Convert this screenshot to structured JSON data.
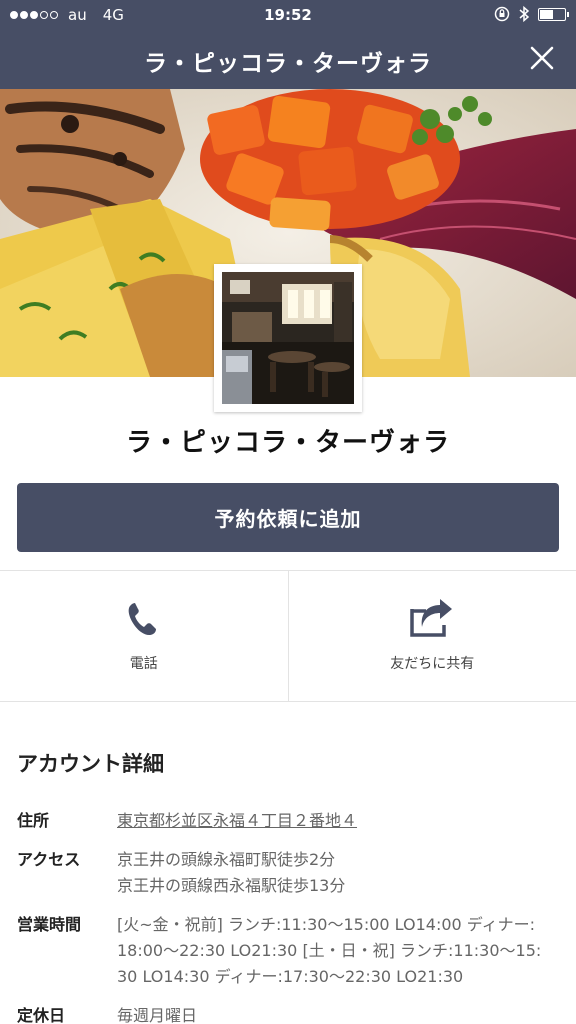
{
  "status_bar": {
    "carrier": "au",
    "network": "4G",
    "time": "19:52",
    "signal_filled": 3,
    "signal_total": 5,
    "battery_level": 0.55
  },
  "nav": {
    "title": "ラ・ピッコラ・ターヴォラ",
    "close_icon": "close-icon"
  },
  "profile": {
    "name": "ラ・ピッコラ・ターヴォラ"
  },
  "reserve_button": {
    "label": "予約依頼に追加"
  },
  "actions": [
    {
      "label": "電話",
      "icon": "phone-icon"
    },
    {
      "label": "友だちに共有",
      "icon": "share-icon"
    }
  ],
  "details": {
    "title": "アカウント詳細",
    "address_label": "住所",
    "address": "東京都杉並区永福４丁目２番地４",
    "access_label": "アクセス",
    "access_line1": "京王井の頭線永福町駅徒歩2分",
    "access_line2": "京王井の頭線西永福駅徒歩13分",
    "hours_label": "営業時間",
    "hours_line1": "[火~金・祝前] ランチ:11:30～15:00 LO14:00 ディナー:",
    "hours_line2": "18:00～22:30 LO21:30 [土・日・祝] ランチ:11:30～15:",
    "hours_line3": "30 LO14:30 ディナー:17:30～22:30 LO21:30",
    "closed_label": "定休日",
    "closed": "毎週月曜日"
  },
  "colors": {
    "header": "#474e65",
    "button": "#474e65"
  }
}
